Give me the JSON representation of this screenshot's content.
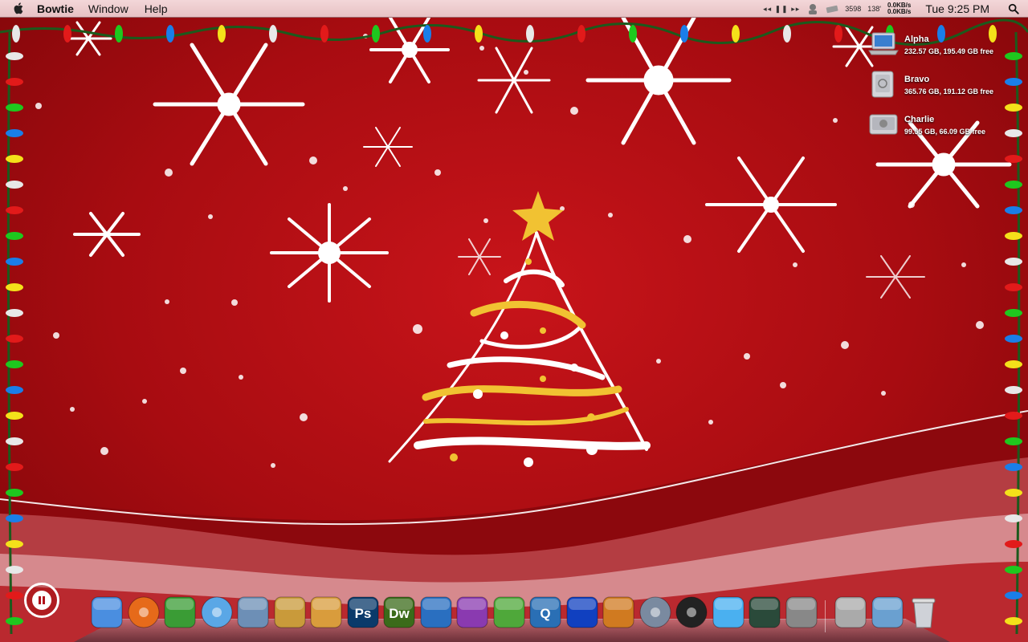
{
  "menubar": {
    "app_name": "Bowtie",
    "menus": [
      "Window",
      "Help"
    ],
    "media_controls": "◂◂  ❚❚  ▸▸",
    "stat_a": "3598",
    "stat_b": "138'",
    "net_up": "0.0KB/s",
    "net_down": "0.0KB/s",
    "clock": "Tue 9:25 PM"
  },
  "drives": [
    {
      "name": "Alpha",
      "info": "232.57 GB, 195.49 GB free",
      "icon": "laptop-drive-icon"
    },
    {
      "name": "Bravo",
      "info": "365.76 GB, 191.12 GB free",
      "icon": "firewire-drive-icon"
    },
    {
      "name": "Charlie",
      "info": "99.55 GB, 66.09 GB free",
      "icon": "apple-drive-icon"
    }
  ],
  "dock": [
    {
      "name": "finder",
      "color": "#4a8ee0"
    },
    {
      "name": "firefox",
      "color": "#e66a1a"
    },
    {
      "name": "adium",
      "color": "#3a9c35"
    },
    {
      "name": "itunes",
      "color": "#5aa7e6"
    },
    {
      "name": "mail",
      "color": "#6d8fb6"
    },
    {
      "name": "iphoto",
      "color": "#c99a3a"
    },
    {
      "name": "preview",
      "color": "#d99c3c"
    },
    {
      "name": "photoshop",
      "color": "#0a3a6a",
      "label": "Ps"
    },
    {
      "name": "dreamweaver",
      "color": "#3b6b1a",
      "label": "Dw"
    },
    {
      "name": "word",
      "color": "#2a6fc0"
    },
    {
      "name": "illustrator-tool",
      "color": "#8a3ab0"
    },
    {
      "name": "messages",
      "color": "#4fa83a"
    },
    {
      "name": "quicktime",
      "color": "#2a6fb5",
      "label": "Q"
    },
    {
      "name": "cyberduck",
      "color": "#1040c0"
    },
    {
      "name": "transmit",
      "color": "#d07a20"
    },
    {
      "name": "disk-utility",
      "color": "#7a8aa0"
    },
    {
      "name": "dvd-player",
      "color": "#222"
    },
    {
      "name": "bluetooth-drop",
      "color": "#4ab0f0"
    },
    {
      "name": "activity-monitor",
      "color": "#2a4a3a"
    },
    {
      "name": "system-preferences",
      "color": "#888"
    },
    {
      "name": "downloads-stack",
      "color": "#aaa"
    },
    {
      "name": "applications-stack",
      "color": "#6aa0d0"
    },
    {
      "name": "trash",
      "color": "#bbb"
    }
  ],
  "colors": {
    "background": "#a80b10",
    "menubar": "#efd0d2"
  }
}
